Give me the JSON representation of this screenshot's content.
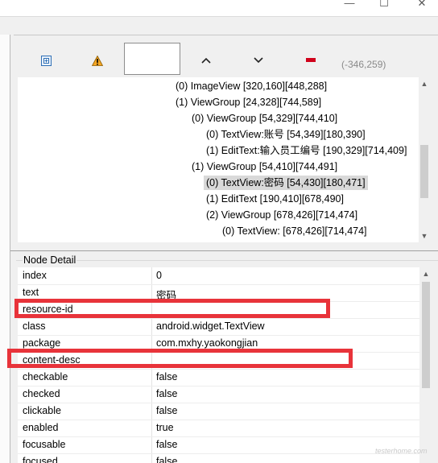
{
  "window": {
    "minimize_glyph": "—",
    "maximize_glyph": "☐",
    "close_glyph": "✕"
  },
  "toolbar": {
    "coords": "(-346,259)"
  },
  "tree": {
    "nodes": [
      "(0) ImageView [320,160][448,288]",
      "(1) ViewGroup [24,328][744,589]",
      "(0) ViewGroup [54,329][744,410]",
      "(0) TextView:账号 [54,349][180,390]",
      "(1) EditText:输入员工编号 [190,329][714,409]",
      "(1) ViewGroup [54,410][744,491]",
      "(0) TextView:密码 [54,430][180,471]",
      "(1) EditText [190,410][678,490]",
      "(2) ViewGroup [678,426][714,474]",
      "(0) TextView:     [678,426][714,474]"
    ]
  },
  "node_detail": {
    "title": "Node Detail",
    "rows": [
      {
        "name": "index",
        "value": "0"
      },
      {
        "name": "text",
        "value": "密码"
      },
      {
        "name": "resource-id",
        "value": ""
      },
      {
        "name": "class",
        "value": "android.widget.TextView"
      },
      {
        "name": "package",
        "value": "com.mxhy.yaokongjian"
      },
      {
        "name": "content-desc",
        "value": ""
      },
      {
        "name": "checkable",
        "value": "false"
      },
      {
        "name": "checked",
        "value": "false"
      },
      {
        "name": "clickable",
        "value": "false"
      },
      {
        "name": "enabled",
        "value": "true"
      },
      {
        "name": "focusable",
        "value": "false"
      },
      {
        "name": "focused",
        "value": "false"
      }
    ]
  },
  "watermark": "testerhome.com",
  "colors": {
    "highlight": "#e8333a",
    "selected_row": "#d9d9d9",
    "remove_icon": "#d0021b",
    "warning_icon": "#f5a623"
  }
}
